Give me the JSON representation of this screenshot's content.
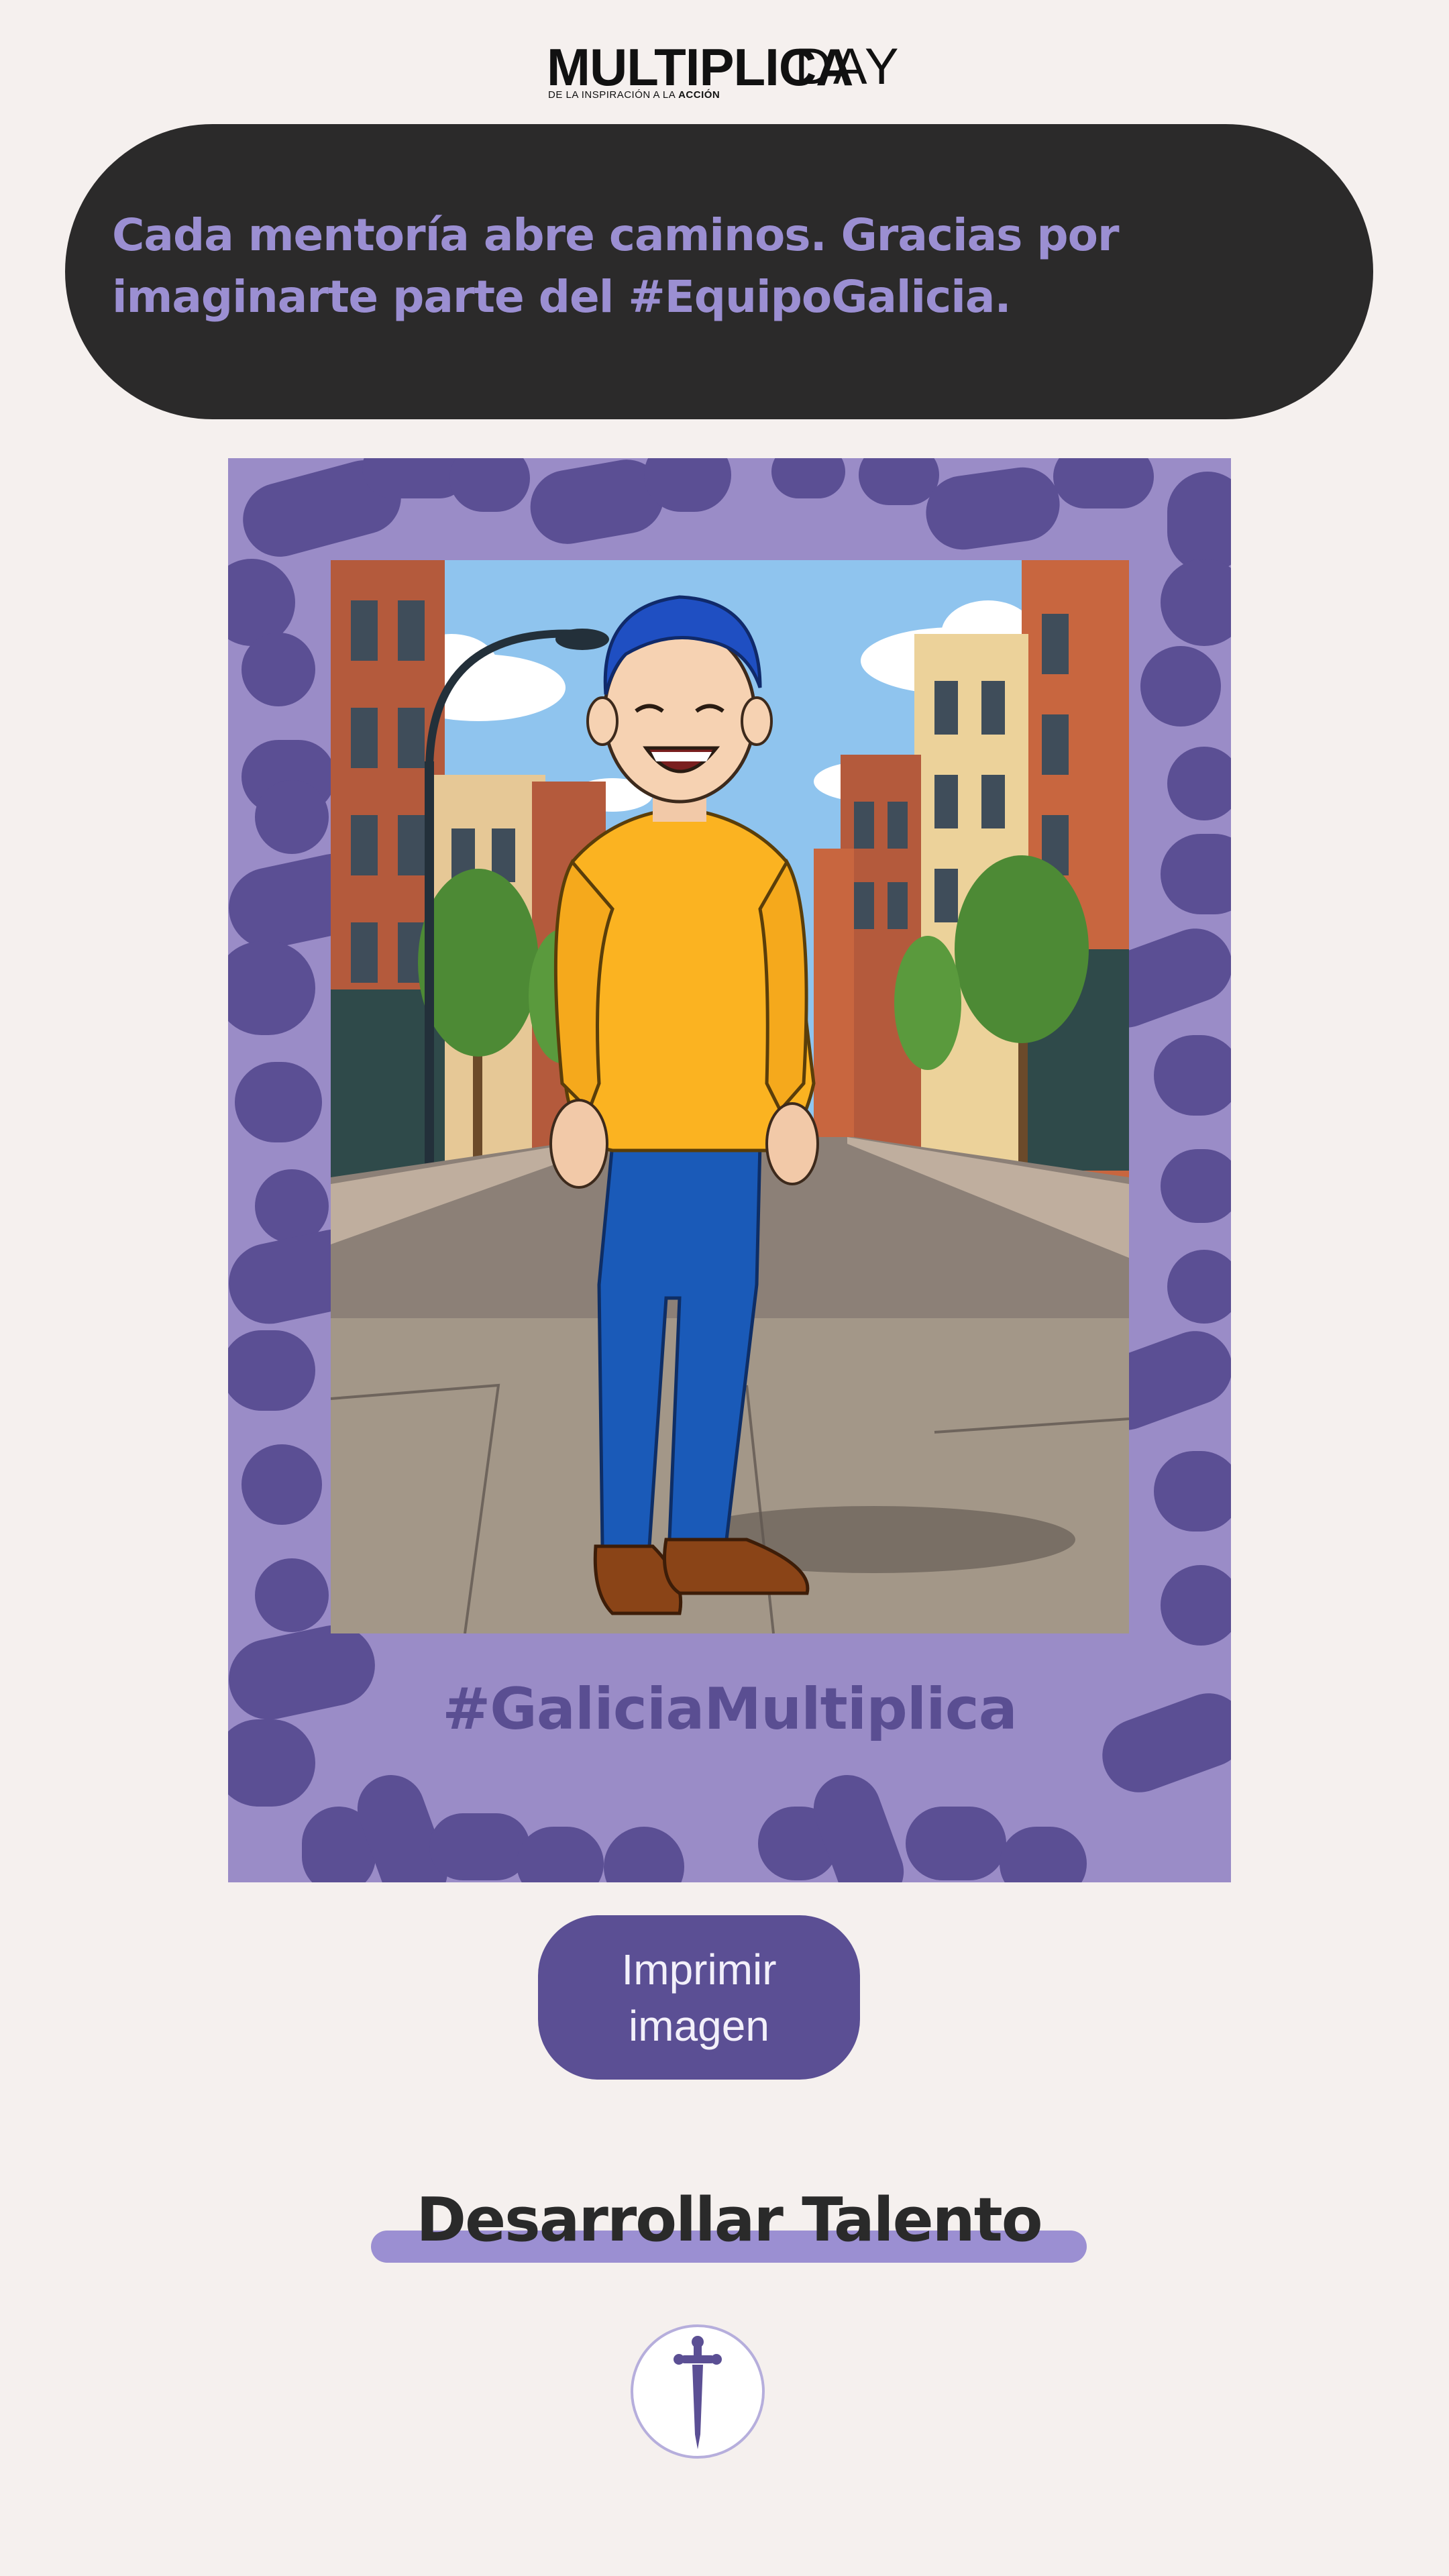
{
  "header": {
    "logo_main": "MULTIPLICA",
    "logo_day": "DAY",
    "logo_tagline_prefix": "DE LA INSPIRACIÓN A LA ",
    "logo_tagline_emphasis": "ACCIÓN"
  },
  "banner": {
    "message": "Cada mentoría abre caminos. Gracias por imaginarte parte del #EquipoGalicia."
  },
  "card": {
    "hashtag": "#GaliciaMultiplica",
    "image_icon": "cartoon-portrait-illustration"
  },
  "actions": {
    "print_label": "Imprimir imagen"
  },
  "section": {
    "title": "Desarrollar Talento",
    "emblem_icon": "sword-emblem-icon"
  },
  "colors": {
    "background": "#f5f0ee",
    "banner": "#2b2a2a",
    "accent_light": "#9b8fd2",
    "accent_dark": "#5b4f94",
    "frame": "#9a8cc7"
  }
}
